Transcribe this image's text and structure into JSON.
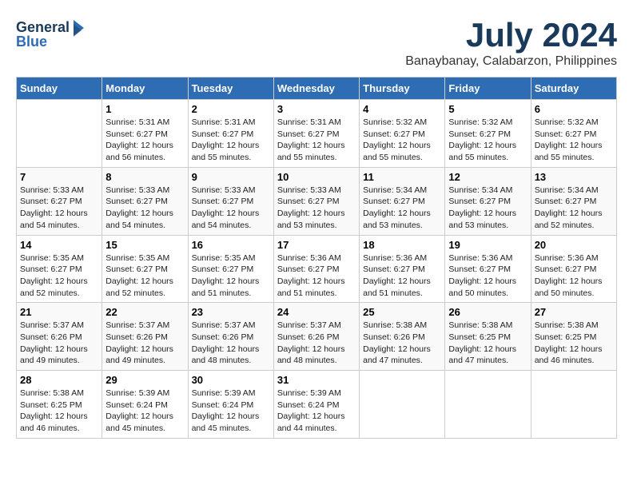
{
  "logo": {
    "line1": "General",
    "line2": "Blue"
  },
  "title": "July 2024",
  "subtitle": "Banaybanay, Calabarzon, Philippines",
  "days_of_week": [
    "Sunday",
    "Monday",
    "Tuesday",
    "Wednesday",
    "Thursday",
    "Friday",
    "Saturday"
  ],
  "weeks": [
    [
      {
        "num": "",
        "content": ""
      },
      {
        "num": "1",
        "content": "Sunrise: 5:31 AM\nSunset: 6:27 PM\nDaylight: 12 hours\nand 56 minutes."
      },
      {
        "num": "2",
        "content": "Sunrise: 5:31 AM\nSunset: 6:27 PM\nDaylight: 12 hours\nand 55 minutes."
      },
      {
        "num": "3",
        "content": "Sunrise: 5:31 AM\nSunset: 6:27 PM\nDaylight: 12 hours\nand 55 minutes."
      },
      {
        "num": "4",
        "content": "Sunrise: 5:32 AM\nSunset: 6:27 PM\nDaylight: 12 hours\nand 55 minutes."
      },
      {
        "num": "5",
        "content": "Sunrise: 5:32 AM\nSunset: 6:27 PM\nDaylight: 12 hours\nand 55 minutes."
      },
      {
        "num": "6",
        "content": "Sunrise: 5:32 AM\nSunset: 6:27 PM\nDaylight: 12 hours\nand 55 minutes."
      }
    ],
    [
      {
        "num": "7",
        "content": "Sunrise: 5:33 AM\nSunset: 6:27 PM\nDaylight: 12 hours\nand 54 minutes."
      },
      {
        "num": "8",
        "content": "Sunrise: 5:33 AM\nSunset: 6:27 PM\nDaylight: 12 hours\nand 54 minutes."
      },
      {
        "num": "9",
        "content": "Sunrise: 5:33 AM\nSunset: 6:27 PM\nDaylight: 12 hours\nand 54 minutes."
      },
      {
        "num": "10",
        "content": "Sunrise: 5:33 AM\nSunset: 6:27 PM\nDaylight: 12 hours\nand 53 minutes."
      },
      {
        "num": "11",
        "content": "Sunrise: 5:34 AM\nSunset: 6:27 PM\nDaylight: 12 hours\nand 53 minutes."
      },
      {
        "num": "12",
        "content": "Sunrise: 5:34 AM\nSunset: 6:27 PM\nDaylight: 12 hours\nand 53 minutes."
      },
      {
        "num": "13",
        "content": "Sunrise: 5:34 AM\nSunset: 6:27 PM\nDaylight: 12 hours\nand 52 minutes."
      }
    ],
    [
      {
        "num": "14",
        "content": "Sunrise: 5:35 AM\nSunset: 6:27 PM\nDaylight: 12 hours\nand 52 minutes."
      },
      {
        "num": "15",
        "content": "Sunrise: 5:35 AM\nSunset: 6:27 PM\nDaylight: 12 hours\nand 52 minutes."
      },
      {
        "num": "16",
        "content": "Sunrise: 5:35 AM\nSunset: 6:27 PM\nDaylight: 12 hours\nand 51 minutes."
      },
      {
        "num": "17",
        "content": "Sunrise: 5:36 AM\nSunset: 6:27 PM\nDaylight: 12 hours\nand 51 minutes."
      },
      {
        "num": "18",
        "content": "Sunrise: 5:36 AM\nSunset: 6:27 PM\nDaylight: 12 hours\nand 51 minutes."
      },
      {
        "num": "19",
        "content": "Sunrise: 5:36 AM\nSunset: 6:27 PM\nDaylight: 12 hours\nand 50 minutes."
      },
      {
        "num": "20",
        "content": "Sunrise: 5:36 AM\nSunset: 6:27 PM\nDaylight: 12 hours\nand 50 minutes."
      }
    ],
    [
      {
        "num": "21",
        "content": "Sunrise: 5:37 AM\nSunset: 6:26 PM\nDaylight: 12 hours\nand 49 minutes."
      },
      {
        "num": "22",
        "content": "Sunrise: 5:37 AM\nSunset: 6:26 PM\nDaylight: 12 hours\nand 49 minutes."
      },
      {
        "num": "23",
        "content": "Sunrise: 5:37 AM\nSunset: 6:26 PM\nDaylight: 12 hours\nand 48 minutes."
      },
      {
        "num": "24",
        "content": "Sunrise: 5:37 AM\nSunset: 6:26 PM\nDaylight: 12 hours\nand 48 minutes."
      },
      {
        "num": "25",
        "content": "Sunrise: 5:38 AM\nSunset: 6:26 PM\nDaylight: 12 hours\nand 47 minutes."
      },
      {
        "num": "26",
        "content": "Sunrise: 5:38 AM\nSunset: 6:25 PM\nDaylight: 12 hours\nand 47 minutes."
      },
      {
        "num": "27",
        "content": "Sunrise: 5:38 AM\nSunset: 6:25 PM\nDaylight: 12 hours\nand 46 minutes."
      }
    ],
    [
      {
        "num": "28",
        "content": "Sunrise: 5:38 AM\nSunset: 6:25 PM\nDaylight: 12 hours\nand 46 minutes."
      },
      {
        "num": "29",
        "content": "Sunrise: 5:39 AM\nSunset: 6:24 PM\nDaylight: 12 hours\nand 45 minutes."
      },
      {
        "num": "30",
        "content": "Sunrise: 5:39 AM\nSunset: 6:24 PM\nDaylight: 12 hours\nand 45 minutes."
      },
      {
        "num": "31",
        "content": "Sunrise: 5:39 AM\nSunset: 6:24 PM\nDaylight: 12 hours\nand 44 minutes."
      },
      {
        "num": "",
        "content": ""
      },
      {
        "num": "",
        "content": ""
      },
      {
        "num": "",
        "content": ""
      }
    ]
  ]
}
